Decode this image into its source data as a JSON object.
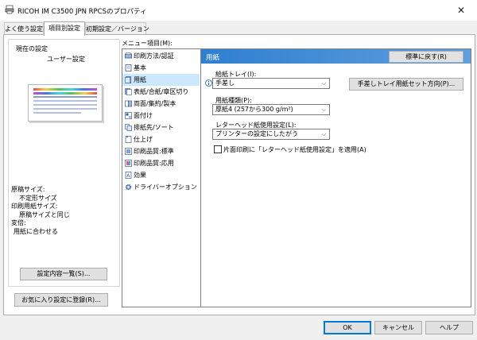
{
  "window": {
    "title": "RICOH IM C3500 JPN RPCSのプロパティ",
    "close_symbol": "✕"
  },
  "tabs": [
    {
      "label": "よく使う設定"
    },
    {
      "label": "項目別設定"
    },
    {
      "label": "初期設定／バージョン"
    }
  ],
  "left_panel": {
    "current_settings_label": "現在の設定",
    "profile_name": "ユーザー設定",
    "summary": [
      "原稿サイズ:",
      "不定形サイズ",
      "印刷用紙サイズ:",
      "原稿サイズと同じ",
      "変倍:",
      "用紙に合わせる"
    ],
    "settings_list_button": "設定内容一覧(S)...",
    "register_favorite_button": "お気に入り設定に登録(R)..."
  },
  "menu": {
    "label": "メニュー項目(M):",
    "items": [
      {
        "label": "印刷方法/認証"
      },
      {
        "label": "基本"
      },
      {
        "label": "用紙"
      },
      {
        "label": "表紙/合紙/章区切り"
      },
      {
        "label": "両面/集約/製本"
      },
      {
        "label": "面付け"
      },
      {
        "label": "排紙先/ソート"
      },
      {
        "label": "仕上げ"
      },
      {
        "label": "印刷品質:標準"
      },
      {
        "label": "印刷品質:応用"
      },
      {
        "label": "効果"
      },
      {
        "label": "ドライバーオプション"
      }
    ]
  },
  "paper_panel": {
    "header": "用紙",
    "reset_button": "標準に戻す(R)",
    "tray_label": "給紙トレイ(I):",
    "tray_value": "手差し",
    "bypass_button": "手差しトレイ用紙セット方向(P)...",
    "type_label": "用紙種類(P):",
    "type_value": "厚紙4 (257から300 g/m²)",
    "letterhead_label": "レターヘッド紙使用設定(L):",
    "letterhead_value": "プリンターの設定にしたがう",
    "simplex_checkbox_label": "片面印刷に「レターヘッド紙使用設定」を適用(A)",
    "simplex_checked": false
  },
  "footer": {
    "ok": "OK",
    "cancel": "キャンセル",
    "help": "ヘルプ"
  },
  "colors": {
    "accent": "#0078d7",
    "selected": "#cce8ff",
    "header_bg": "#4a8fd1"
  }
}
